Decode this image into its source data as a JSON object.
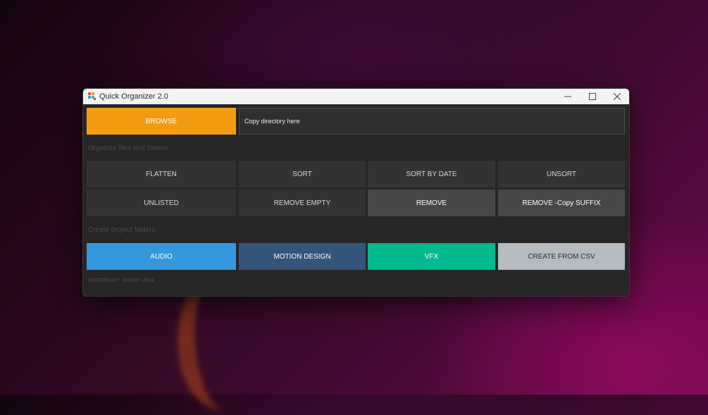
{
  "window": {
    "title": "Quick Organizer 2.0",
    "controls": {
      "minimize_icon": "minimize-icon",
      "maximize_icon": "maximize-icon",
      "close_icon": "close-icon"
    }
  },
  "browse": {
    "label": "BROWSE",
    "color": "#f39c12"
  },
  "directory_field": {
    "value": "Copy directory here"
  },
  "organize": {
    "section_label": "Organize files and folders",
    "buttons": [
      "FLATTEN",
      "SORT",
      "SORT BY DATE",
      "UNSORT",
      "UNLISTED",
      "REMOVE EMPTY",
      "REMOVE",
      "REMOVE -Copy SUFFIX"
    ]
  },
  "create": {
    "section_label": "Create project folders",
    "buttons": [
      {
        "label": "AUDIO",
        "color": "#3498db"
      },
      {
        "label": "MOTION DESIGN",
        "color": "#34557a"
      },
      {
        "label": "VFX",
        "color": "#00b98c"
      },
      {
        "label": "CREATE FROM CSV",
        "color": "#b4bcc2"
      }
    ]
  },
  "footer": {
    "credit": "CREATED BY: JORISE LEGA"
  }
}
